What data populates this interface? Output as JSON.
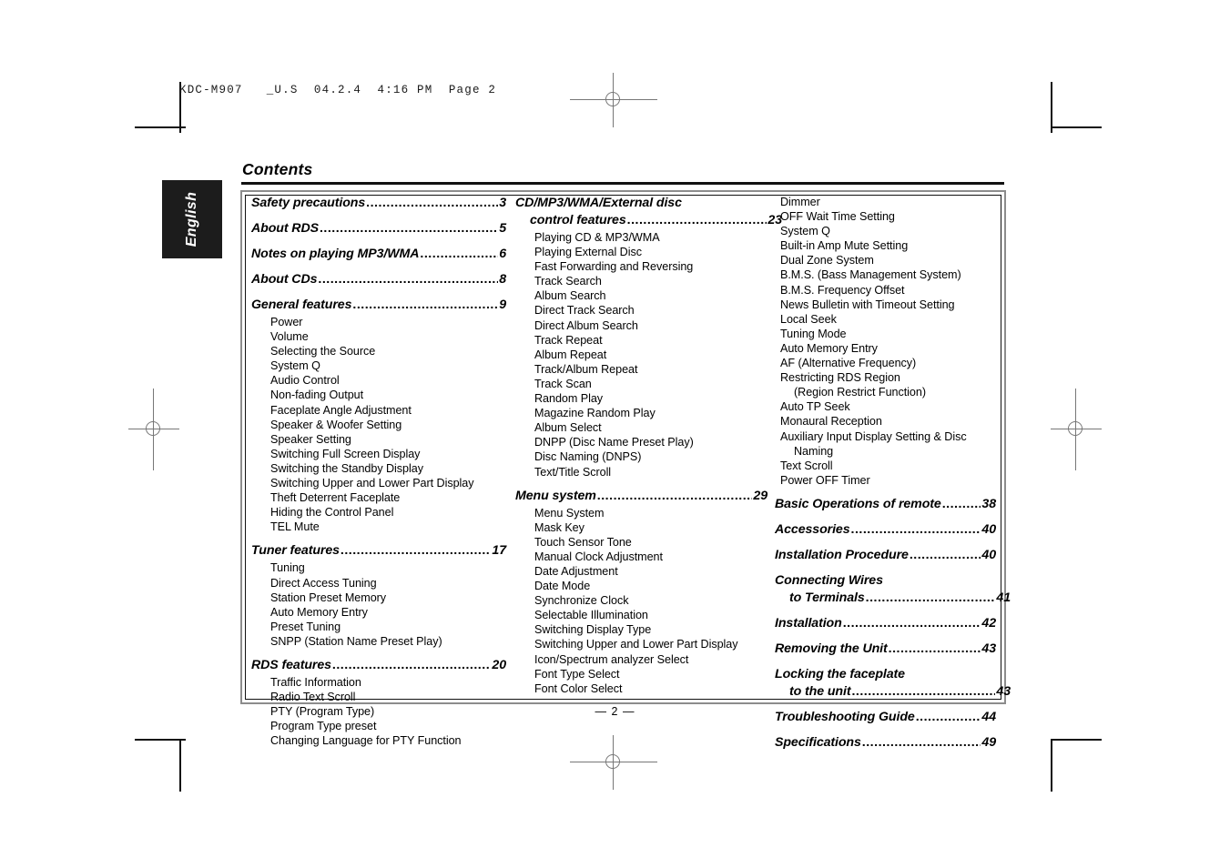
{
  "print_header": "KDC-M907   _U.S  04.2.4  4:16 PM  Page 2",
  "language_tab": "English",
  "page_title": "Contents",
  "page_footer": "— 2 —",
  "dot_leader": "..........................................................",
  "columns": [
    {
      "id": "column-1",
      "blocks": [
        {
          "type": "heading",
          "text": "Safety precautions",
          "page": "3"
        },
        {
          "type": "heading",
          "text": "About RDS ",
          "page": "5"
        },
        {
          "type": "heading",
          "text": "Notes on playing MP3/WMA",
          "page": "6"
        },
        {
          "type": "heading",
          "text": "About CDs",
          "page": "8"
        },
        {
          "type": "heading",
          "text": "General features ",
          "page": "9"
        },
        {
          "type": "item",
          "text": "Power"
        },
        {
          "type": "item",
          "text": "Volume"
        },
        {
          "type": "item",
          "text": "Selecting the Source"
        },
        {
          "type": "item",
          "text": "System Q"
        },
        {
          "type": "item",
          "text": "Audio Control"
        },
        {
          "type": "item",
          "text": "Non-fading Output"
        },
        {
          "type": "item",
          "text": "Faceplate Angle Adjustment"
        },
        {
          "type": "item",
          "text": "Speaker & Woofer Setting"
        },
        {
          "type": "item",
          "text": "Speaker Setting"
        },
        {
          "type": "item",
          "text": "Switching Full Screen Display"
        },
        {
          "type": "item",
          "text": "Switching the Standby Display"
        },
        {
          "type": "item",
          "text": "Switching Upper and Lower Part Display"
        },
        {
          "type": "item",
          "text": "Theft Deterrent Faceplate"
        },
        {
          "type": "item",
          "text": "Hiding the Control Panel"
        },
        {
          "type": "item",
          "text": "TEL Mute"
        },
        {
          "type": "heading",
          "text": "Tuner features",
          "page": "17"
        },
        {
          "type": "item",
          "text": "Tuning"
        },
        {
          "type": "item",
          "text": "Direct Access Tuning"
        },
        {
          "type": "item",
          "text": "Station Preset Memory"
        },
        {
          "type": "item",
          "text": "Auto Memory Entry"
        },
        {
          "type": "item",
          "text": "Preset Tuning"
        },
        {
          "type": "item",
          "text": "SNPP (Station Name Preset Play)"
        },
        {
          "type": "heading",
          "text": "RDS features ",
          "page": "20"
        },
        {
          "type": "item",
          "text": "Traffic Information"
        },
        {
          "type": "item",
          "text": "Radio Text Scroll"
        },
        {
          "type": "item",
          "text": "PTY (Program Type)"
        },
        {
          "type": "item",
          "text": "Program Type preset"
        },
        {
          "type": "item",
          "text": "Changing Language for PTY Function"
        }
      ]
    },
    {
      "id": "column-2",
      "blocks": [
        {
          "type": "heading-wrap",
          "line1": "CD/MP3/WMA/External disc",
          "text": "control features ",
          "page": "23"
        },
        {
          "type": "item",
          "text": "Playing CD & MP3/WMA"
        },
        {
          "type": "item",
          "text": "Playing External Disc"
        },
        {
          "type": "item",
          "text": "Fast Forwarding and Reversing"
        },
        {
          "type": "item",
          "text": "Track Search"
        },
        {
          "type": "item",
          "text": "Album Search"
        },
        {
          "type": "item",
          "text": "Direct Track Search"
        },
        {
          "type": "item",
          "text": "Direct Album Search"
        },
        {
          "type": "item",
          "text": "Track Repeat"
        },
        {
          "type": "item",
          "text": "Album Repeat"
        },
        {
          "type": "item",
          "text": "Track/Album Repeat"
        },
        {
          "type": "item",
          "text": "Track Scan"
        },
        {
          "type": "item",
          "text": "Random Play"
        },
        {
          "type": "item",
          "text": "Magazine Random Play"
        },
        {
          "type": "item",
          "text": "Album Select"
        },
        {
          "type": "item",
          "text": "DNPP (Disc Name Preset Play)"
        },
        {
          "type": "item",
          "text": "Disc Naming (DNPS)"
        },
        {
          "type": "item",
          "text": "Text/Title Scroll"
        },
        {
          "type": "heading",
          "text": "Menu system",
          "page": "29"
        },
        {
          "type": "item",
          "text": "Menu System"
        },
        {
          "type": "item",
          "text": "Mask Key"
        },
        {
          "type": "item",
          "text": "Touch Sensor Tone"
        },
        {
          "type": "item",
          "text": "Manual Clock Adjustment"
        },
        {
          "type": "item",
          "text": "Date Adjustment"
        },
        {
          "type": "item",
          "text": "Date Mode"
        },
        {
          "type": "item",
          "text": "Synchronize Clock"
        },
        {
          "type": "item",
          "text": "Selectable Illumination"
        },
        {
          "type": "item",
          "text": "Switching Display Type"
        },
        {
          "type": "item",
          "text": "Switching Upper and Lower Part Display"
        },
        {
          "type": "item",
          "text": "Icon/Spectrum analyzer Select"
        },
        {
          "type": "item",
          "text": "Font Type Select"
        },
        {
          "type": "item",
          "text": "Font Color Select"
        }
      ]
    },
    {
      "id": "column-3",
      "blocks": [
        {
          "type": "item",
          "text": "Dimmer",
          "flush": true
        },
        {
          "type": "item",
          "text": "OFF Wait Time Setting",
          "flush": true
        },
        {
          "type": "item",
          "text": "System Q",
          "flush": true
        },
        {
          "type": "item",
          "text": "Built-in Amp Mute Setting",
          "flush": true
        },
        {
          "type": "item",
          "text": "Dual Zone System",
          "flush": true
        },
        {
          "type": "item",
          "text": "B.M.S. (Bass Management System)",
          "flush": true
        },
        {
          "type": "item",
          "text": "B.M.S. Frequency Offset",
          "flush": true
        },
        {
          "type": "item",
          "text": "News Bulletin with Timeout Setting",
          "flush": true
        },
        {
          "type": "item",
          "text": "Local Seek",
          "flush": true
        },
        {
          "type": "item",
          "text": "Tuning Mode",
          "flush": true
        },
        {
          "type": "item",
          "text": "Auto Memory Entry",
          "flush": true
        },
        {
          "type": "item",
          "text": "AF (Alternative Frequency)",
          "flush": true
        },
        {
          "type": "item",
          "text": "Restricting RDS Region",
          "flush": true
        },
        {
          "type": "item",
          "text": "(Region Restrict Function)",
          "cont": true
        },
        {
          "type": "item",
          "text": "Auto TP Seek",
          "flush": true
        },
        {
          "type": "item",
          "text": "Monaural Reception",
          "flush": true
        },
        {
          "type": "item",
          "text": "Auxiliary Input Display Setting & Disc",
          "flush": true
        },
        {
          "type": "item",
          "text": "Naming",
          "cont": true
        },
        {
          "type": "item",
          "text": "Text Scroll",
          "flush": true
        },
        {
          "type": "item",
          "text": "Power OFF Timer",
          "flush": true
        },
        {
          "type": "heading",
          "text": "Basic Operations of remote",
          "page": "38"
        },
        {
          "type": "heading",
          "text": "Accessories",
          "page": "40"
        },
        {
          "type": "heading",
          "text": "Installation Procedure ",
          "page": "40"
        },
        {
          "type": "heading-wrap",
          "line1": "Connecting Wires",
          "text": "to Terminals ",
          "page": "41"
        },
        {
          "type": "heading",
          "text": "Installation ",
          "page": "42"
        },
        {
          "type": "heading",
          "text": "Removing the Unit",
          "page": "43"
        },
        {
          "type": "heading-wrap",
          "line1": "Locking the faceplate",
          "text": "to the unit ",
          "page": "43"
        },
        {
          "type": "heading",
          "text": "Troubleshooting Guide ",
          "page": "44"
        },
        {
          "type": "heading",
          "text": "Specifications ",
          "page": "49"
        }
      ]
    }
  ]
}
